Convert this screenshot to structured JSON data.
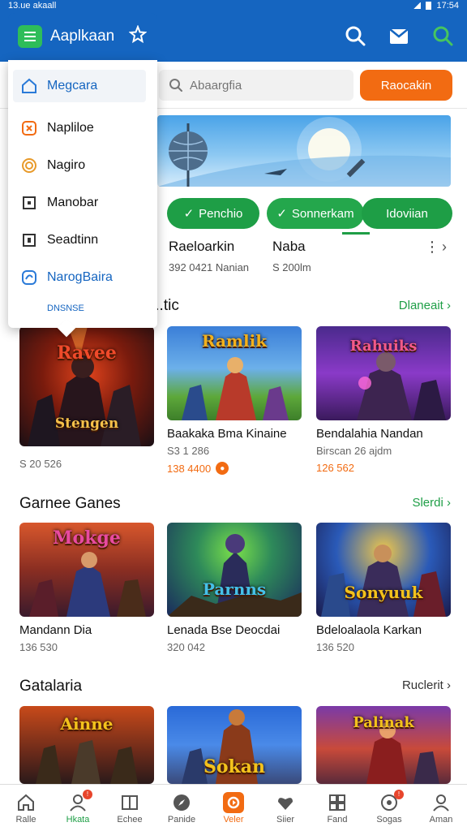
{
  "status_bar": {
    "time": "13.ue akaall",
    "right_text": "17:54"
  },
  "app": {
    "title": "Aaplkaan"
  },
  "drawer": {
    "items": [
      {
        "label": "Megcara",
        "icon": "home-icon"
      },
      {
        "label": "Napliloe",
        "icon": "game-controller-icon"
      },
      {
        "label": "Nagiro",
        "icon": "target-icon"
      },
      {
        "label": "Manobar",
        "icon": "square-icon"
      },
      {
        "label": "Seadtinn",
        "icon": "square-icon"
      },
      {
        "label": "NarogBaira",
        "icon": "refresh-icon"
      }
    ],
    "footer": "DNSNSE"
  },
  "search": {
    "placeholder": "Abaargfia",
    "button_label": "Raocakin"
  },
  "chips": [
    {
      "label": "Penchio"
    },
    {
      "label": "Sonnerkam"
    },
    {
      "label": "Idoviian"
    }
  ],
  "info": {
    "left_title": "Raeloarkin",
    "left_sub": "392 0421 Nanian",
    "right_title": "Naba",
    "right_sub": "S 200lm"
  },
  "sections": [
    {
      "title": "...tic",
      "link": "Dlaneait"
    },
    {
      "title": "Garnee Ganes",
      "link": "Slerdi"
    },
    {
      "title": "Gatalaria",
      "link": "Ruclerit"
    }
  ],
  "section1_cards": [
    {
      "art": "Stengen",
      "title_art": "Ravee",
      "name": "",
      "meta": "S 20 526",
      "price": ""
    },
    {
      "art": "",
      "title_art": "Ramlik",
      "name": "Baakaka Bma Kinaine",
      "meta": "S3 1 286",
      "price": "138 4400"
    },
    {
      "art": "",
      "title_art": "Rahuiks",
      "name": "Bendalahia Nandan",
      "meta": "Birscan 26 ajdm",
      "price": "126 562"
    }
  ],
  "section2_cards": [
    {
      "title_art": "Mokge",
      "name": "Mandann Dia",
      "meta": "136 530"
    },
    {
      "title_art": "Parnns",
      "name": "Lenada Bse Deocdai",
      "meta": "320 042"
    },
    {
      "title_art": "Sonyuuk",
      "name": "Bdeloalaola Karkan",
      "meta": "136 520"
    }
  ],
  "section3_cards": [
    {
      "title_art": "Ainne"
    },
    {
      "title_art": "Sokan"
    },
    {
      "title_art": "Palinak"
    }
  ],
  "bottom_nav": [
    {
      "label": "Ralle",
      "icon": "home-icon"
    },
    {
      "label": "Hkata",
      "icon": "user-icon"
    },
    {
      "label": "Echee",
      "icon": "book-icon"
    },
    {
      "label": "Panide",
      "icon": "compass-icon"
    },
    {
      "label": "Veler",
      "icon": "play-icon"
    },
    {
      "label": "Siier",
      "icon": "heart-icon"
    },
    {
      "label": "Fand",
      "icon": "grid-icon"
    },
    {
      "label": "Sogas",
      "icon": "gamepad-icon"
    },
    {
      "label": "Aman",
      "icon": "profile-icon"
    }
  ],
  "colors": {
    "brand_blue": "#1565c0",
    "accent_green": "#1e9e46",
    "accent_orange": "#f26b12"
  }
}
